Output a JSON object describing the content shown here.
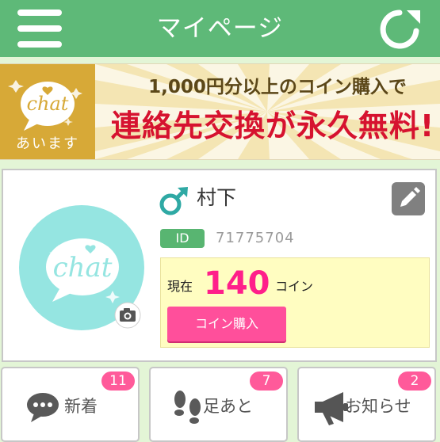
{
  "header": {
    "title": "マイページ",
    "menu_icon": "hamburger-icon",
    "refresh_icon": "refresh-icon",
    "bg_color": "#5eb978"
  },
  "banner": {
    "logo_text": "chat",
    "logo_subtext": "あいます",
    "line1": "1,000円分以上のコイン購入で",
    "line2": "連絡先交換が永久無料!"
  },
  "profile": {
    "gender_icon": "male-icon",
    "name": "村下",
    "edit_icon": "pencil-icon",
    "camera_icon": "camera-icon",
    "avatar_text": "chat",
    "id_label": "ID",
    "id_value": "71775704",
    "coin_prefix": "現在",
    "coin_amount": "140",
    "coin_unit": "コイン",
    "buy_button": "コイン購入",
    "accent_color": "#ff1f8a"
  },
  "tiles": [
    {
      "icon": "chat-bubble-icon",
      "label": "新着",
      "badge": "11"
    },
    {
      "icon": "footprints-icon",
      "label": "足あと",
      "badge": "7"
    },
    {
      "icon": "megaphone-icon",
      "label": "お知らせ",
      "badge": "2"
    }
  ]
}
